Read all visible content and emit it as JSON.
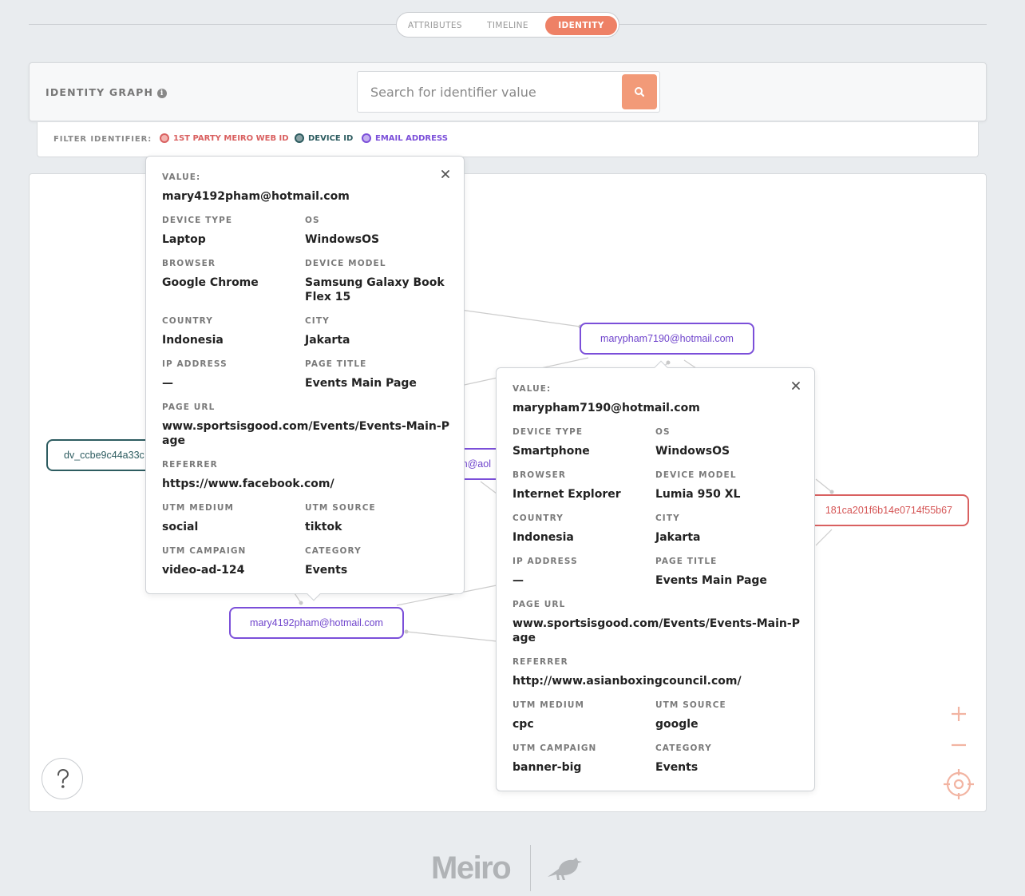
{
  "tabs": [
    {
      "label": "ATTRIBUTES",
      "active": false
    },
    {
      "label": "TIMELINE",
      "active": false
    },
    {
      "label": "IDENTITY",
      "active": true
    }
  ],
  "identity_graph": {
    "title": "IDENTITY GRAPH",
    "search_placeholder": "Search for identifier value"
  },
  "filter": {
    "label": "FILTER IDENTIFIER:",
    "chips": [
      {
        "label": "1ST PARTY MEIRO WEB ID",
        "color": "#d96060",
        "fill": "#f3b4b0"
      },
      {
        "label": "DEVICE ID",
        "color": "#2d5c60",
        "fill": "#8aa3a6"
      },
      {
        "label": "EMAIL ADDRESS",
        "color": "#7b4fd9",
        "fill": "#c4aff0"
      }
    ]
  },
  "nodes": {
    "email_1": "marypham7190@hotmail.com",
    "email_2": "mary4192pham@hotmail.com",
    "email_3": "m@aol",
    "device_1": "dv_ccbe9c44a33c",
    "web_1": "181ca201f6b14e0714f55b67"
  },
  "popup1": {
    "value_label": "VALUE:",
    "value": "mary4192pham@hotmail.com",
    "fields": {
      "device_type_label": "DEVICE TYPE",
      "device_type": "Laptop",
      "os_label": "OS",
      "os": "WindowsOS",
      "browser_label": "BROWSER",
      "browser": "Google Chrome",
      "device_model_label": "DEVICE MODEL",
      "device_model": "Samsung Galaxy Book Flex 15",
      "country_label": "COUNTRY",
      "country": "Indonesia",
      "city_label": "CITY",
      "city": "Jakarta",
      "ip_label": "IP ADDRESS",
      "ip": "—",
      "page_title_label": "PAGE TITLE",
      "page_title": "Events Main Page",
      "page_url_label": "PAGE URL",
      "page_url": "www.sportsisgood.com/Events/Events-Main-Page",
      "referrer_label": "REFERRER",
      "referrer": "https://www.facebook.com/",
      "utm_medium_label": "UTM MEDIUM",
      "utm_medium": "social",
      "utm_source_label": "UTM SOURCE",
      "utm_source": "tiktok",
      "utm_campaign_label": "UTM CAMPAIGN",
      "utm_campaign": "video-ad-124",
      "category_label": "CATEGORY",
      "category": "Events"
    }
  },
  "popup2": {
    "value_label": "VALUE:",
    "value": "marypham7190@hotmail.com",
    "fields": {
      "device_type_label": "DEVICE TYPE",
      "device_type": "Smartphone",
      "os_label": "OS",
      "os": "WindowsOS",
      "browser_label": "BROWSER",
      "browser": "Internet Explorer",
      "device_model_label": "DEVICE MODEL",
      "device_model": "Lumia 950 XL",
      "country_label": "COUNTRY",
      "country": "Indonesia",
      "city_label": "CITY",
      "city": "Jakarta",
      "ip_label": "IP ADDRESS",
      "ip": "—",
      "page_title_label": "PAGE TITLE",
      "page_title": "Events Main Page",
      "page_url_label": "PAGE URL",
      "page_url": "www.sportsisgood.com/Events/Events-Main-Page",
      "referrer_label": "REFERRER",
      "referrer": "http://www.asianboxingcouncil.com/",
      "utm_medium_label": "UTM MEDIUM",
      "utm_medium": "cpc",
      "utm_source_label": "UTM SOURCE",
      "utm_source": "google",
      "utm_campaign_label": "UTM CAMPAIGN",
      "utm_campaign": "banner-big",
      "category_label": "CATEGORY",
      "category": "Events"
    }
  },
  "footer": {
    "logo": "Meiro"
  },
  "colors": {
    "accent": "#ee8166",
    "email": "#7b4fd9",
    "device": "#2d5c60",
    "web": "#d96060"
  }
}
